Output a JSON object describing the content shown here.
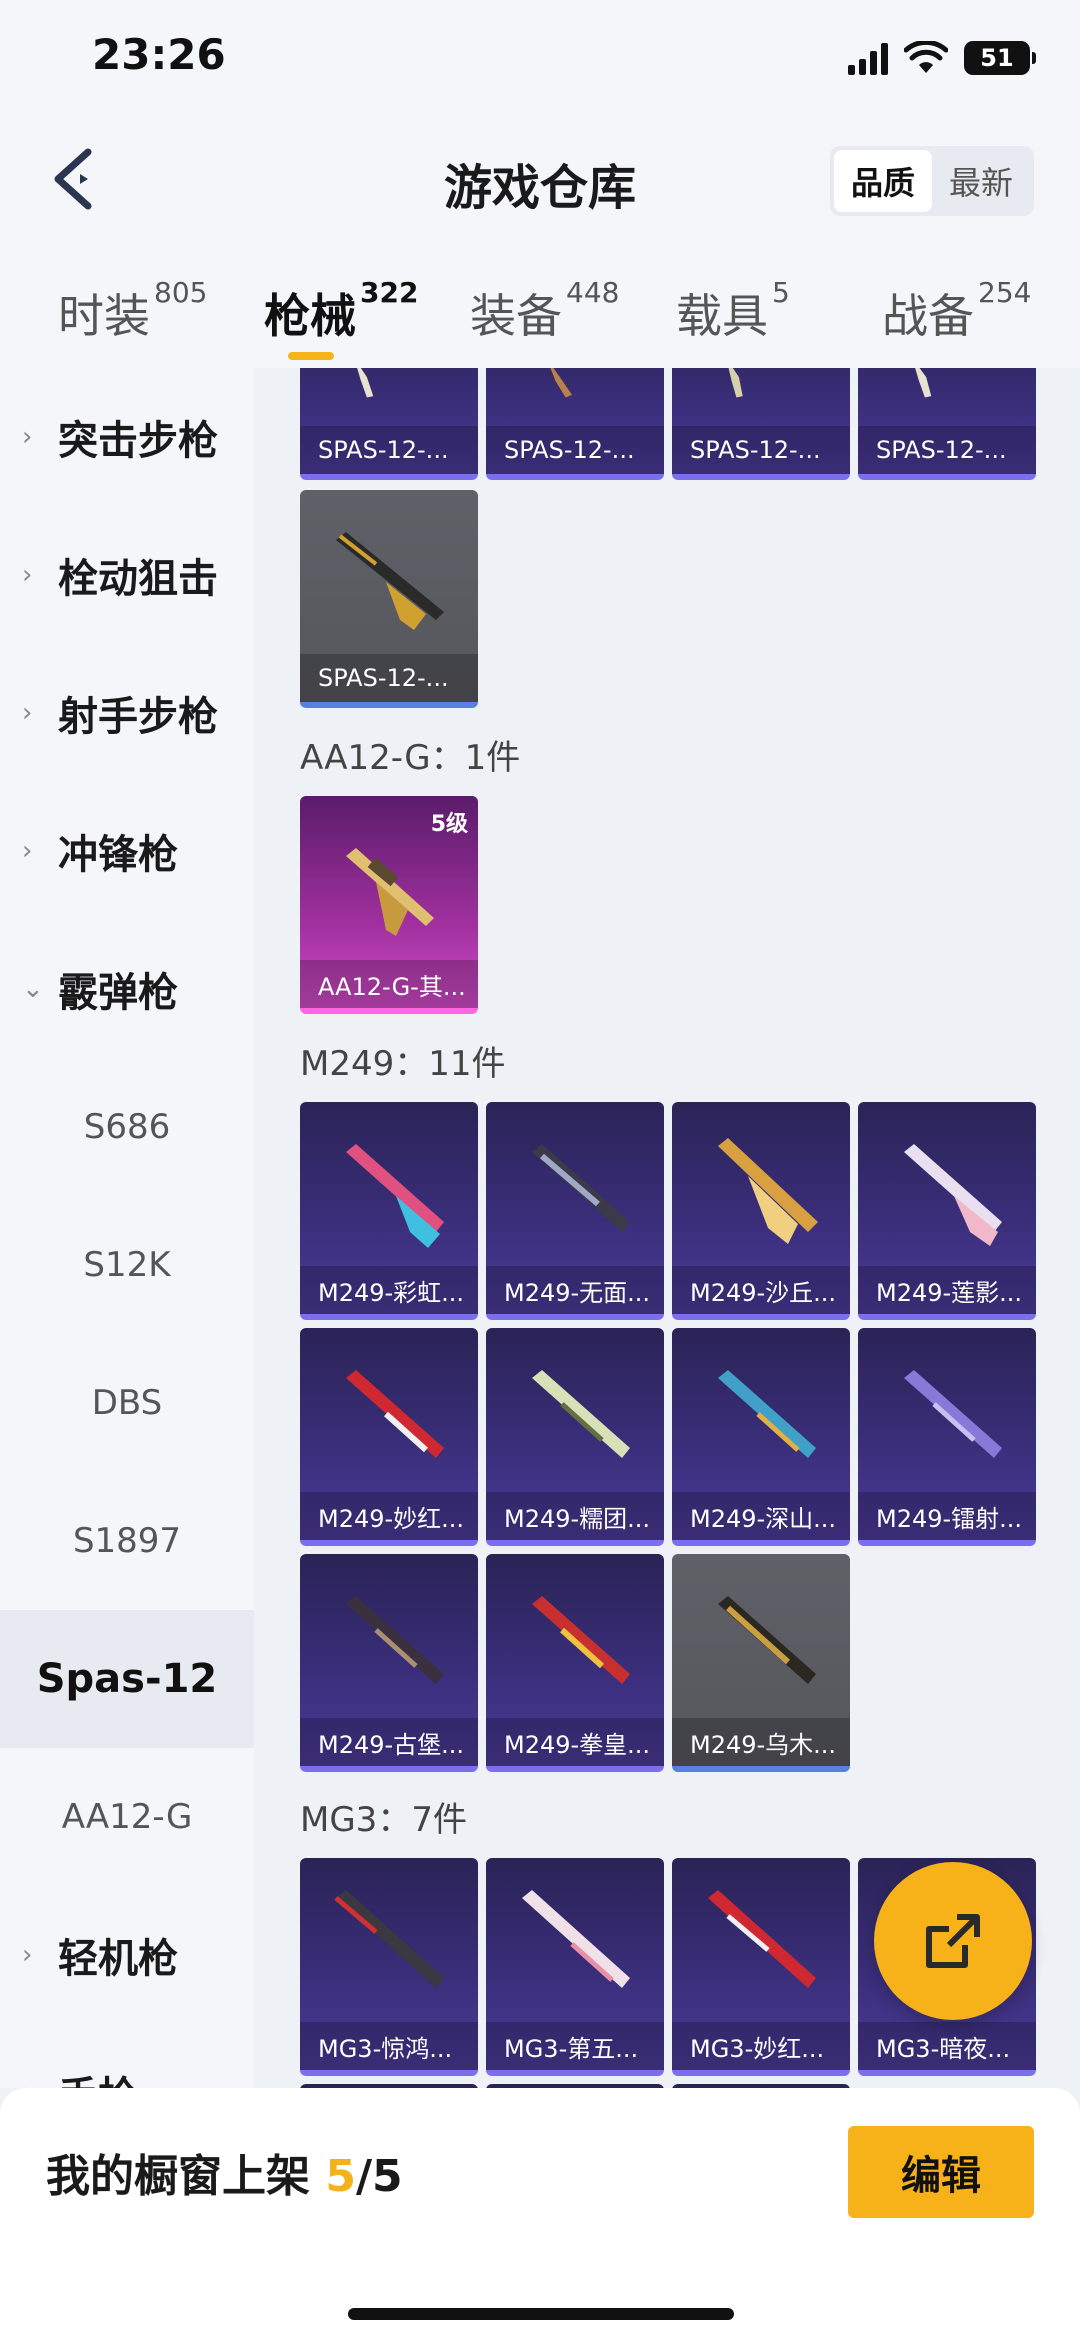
{
  "status": {
    "time": "23:26",
    "battery": "51"
  },
  "header": {
    "title": "游戏仓库",
    "seg": [
      "品质",
      "最新"
    ],
    "seg_active": 0
  },
  "tabs": [
    {
      "label": "时装",
      "count": "805"
    },
    {
      "label": "枪械",
      "count": "322"
    },
    {
      "label": "装备",
      "count": "448"
    },
    {
      "label": "载具",
      "count": "5"
    },
    {
      "label": "战备",
      "count": "254"
    }
  ],
  "sidebar": [
    {
      "label": "突击步枪",
      "type": "parent",
      "chev": "›"
    },
    {
      "label": "栓动狙击",
      "type": "parent",
      "chev": "›"
    },
    {
      "label": "射手步枪",
      "type": "parent",
      "chev": "›"
    },
    {
      "label": "冲锋枪",
      "type": "parent",
      "chev": "›"
    },
    {
      "label": "霰弹枪",
      "type": "parent",
      "chev": "⌄"
    },
    {
      "label": "S686",
      "type": "child"
    },
    {
      "label": "S12K",
      "type": "child"
    },
    {
      "label": "DBS",
      "type": "child"
    },
    {
      "label": "S1897",
      "type": "child"
    },
    {
      "label": "Spas-12",
      "type": "child",
      "selected": true
    },
    {
      "label": "AA12-G",
      "type": "child"
    },
    {
      "label": "轻机枪",
      "type": "parent",
      "chev": "›"
    },
    {
      "label": "手枪",
      "type": "parent",
      "chev": "›"
    }
  ],
  "groups": {
    "aa12": "AA12-G：1件",
    "m249": "M249：11件",
    "mg3": "MG3：7件"
  },
  "cards": {
    "spas_top": [
      "SPAS-12-...",
      "SPAS-12-...",
      "SPAS-12-...",
      "SPAS-12-..."
    ],
    "spas_gray": "SPAS-12-...",
    "aa12": {
      "name": "AA12-G-其...",
      "level": "5级"
    },
    "m249": [
      "M249-彩虹...",
      "M249-无面...",
      "M249-沙丘...",
      "M249-莲影...",
      "M249-妙红...",
      "M249-糯团...",
      "M249-深山...",
      "M249-镭射...",
      "M249-古堡...",
      "M249-拳皇...",
      "M249-乌木..."
    ],
    "mg3": [
      "MG3-惊鸿...",
      "MG3-第五...",
      "MG3-妙红...",
      "MG3-暗夜..."
    ]
  },
  "bottom": {
    "showcase_prefix": "我的橱窗上架 ",
    "count": "5",
    "total": "/5",
    "edit": "编辑"
  },
  "colors": {
    "accent": "#f7b119",
    "card_purple": "#3a2e7a",
    "card_pink": "#d04cc8"
  },
  "icons": {
    "back": "back-chevron-icon",
    "fab": "share-external-icon"
  }
}
